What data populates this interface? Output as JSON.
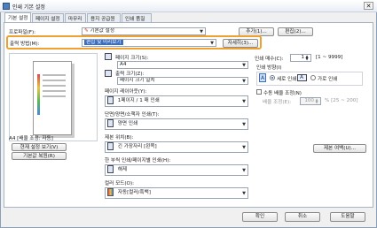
{
  "window": {
    "title": "인쇄 기본 설정",
    "close_glyph": "✕"
  },
  "tabs": [
    {
      "label": "기본 설정"
    },
    {
      "label": "페이지 설정"
    },
    {
      "label": "마무리"
    },
    {
      "label": "용지 공급원"
    },
    {
      "label": "인쇄 품질"
    }
  ],
  "profile": {
    "label": "프로파일(F):",
    "value": "기본값 설정",
    "add_button": "추가(1)...",
    "edit_button": "편집(2)..."
  },
  "output": {
    "label": "출력 방법(M):",
    "value": "편집 및 미리보기",
    "detail_button": "자세히(3)..."
  },
  "preview": {
    "caption": "A4 [배율 조정: 자동]",
    "view_button": "현재 설정 보기(V)",
    "restore_button": "기본값 복원(R)"
  },
  "page_size": {
    "label": "페이지 크기(S):",
    "value": "A4"
  },
  "output_size": {
    "label": "출력 크기(Z):",
    "value": "페이지 크기 일치"
  },
  "layout": {
    "label": "페이지 레이아웃(Y):",
    "value": "1페이지 / 1 매 인쇄"
  },
  "duplex": {
    "label": "단면/양면/소책자 인쇄(T):",
    "value": "양면 인쇄"
  },
  "binding": {
    "label": "제본 위치(B):",
    "value": "긴 가장자리 [왼쪽]"
  },
  "bw_pages": {
    "label": "한 부씩 인쇄/페이지별 인쇄(H):",
    "value": "해제"
  },
  "color_mode": {
    "label": "컬러 모드(O):",
    "value": "자동[컬러/흑백]"
  },
  "copies": {
    "label": "인쇄 매수(C):",
    "value": "1",
    "range": "[1 ~ 9999]"
  },
  "orientation": {
    "label": "인쇄 방향(I)",
    "portrait": "세로 인쇄",
    "landscape": "가로 인쇄"
  },
  "manual_scaling": {
    "label": "수동 배율 조정(N)",
    "scale_label": "배율 조정(E):",
    "scale_value": "100",
    "scale_range": "% [25 ~ 200]"
  },
  "margin_button": "제본 여백(U)...",
  "footer": {
    "ok": "확인",
    "cancel": "취소",
    "help": "도움말"
  }
}
